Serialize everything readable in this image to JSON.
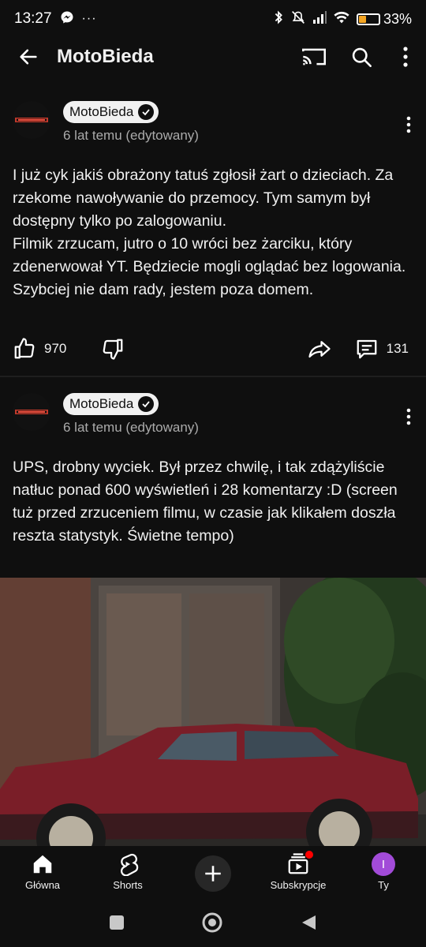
{
  "status_bar": {
    "time": "13:27",
    "overflow": "···",
    "battery_percent": "33%",
    "battery_level": 0.33,
    "battery_color": "#f5a623"
  },
  "app_bar": {
    "title": "MotoBieda",
    "icons": [
      "back-arrow-icon",
      "cast-icon",
      "search-icon",
      "more-vert-icon"
    ]
  },
  "posts": [
    {
      "channel": "MotoBieda",
      "time": "6 lat temu (edytowany)",
      "text": "I już cyk jakiś obrażony tatuś zgłosił żart o dzieciach. Za rzekome nawoływanie do przemocy. Tym samym był dostępny tylko po zalogowaniu.\nFilmik zrzucam, jutro o 10 wróci bez żarciku, który zdenerwował YT. Będziecie mogli oglądać bez logowania. Szybciej nie dam rady, jestem poza domem.",
      "likes": "970",
      "comments": "131"
    },
    {
      "channel": "MotoBieda",
      "time": "6 lat temu (edytowany)",
      "text": "UPS, drobny wyciek. Był przez chwilę, i tak zdążyliście natłuc ponad 600 wyświetleń i 28 komentarzy :D (screen tuż przed zrzuceniem filmu, w czasie jak klikałem doszła reszta statystyk. Świetne tempo)"
    }
  ],
  "bottom_nav": {
    "items": [
      {
        "label": "Główna",
        "icon": "home-icon"
      },
      {
        "label": "Shorts",
        "icon": "shorts-icon"
      },
      {
        "label": "",
        "icon": "create-plus-icon"
      },
      {
        "label": "Subskrypcje",
        "icon": "subscriptions-icon"
      },
      {
        "label": "Ty",
        "icon": "avatar-icon",
        "avatar_letter": "I"
      }
    ]
  },
  "colors": {
    "background": "#0f0f0f",
    "text_secondary": "#aaaaaa",
    "avatar_purple": "#a24bd8",
    "notification_red": "#ff0000"
  }
}
